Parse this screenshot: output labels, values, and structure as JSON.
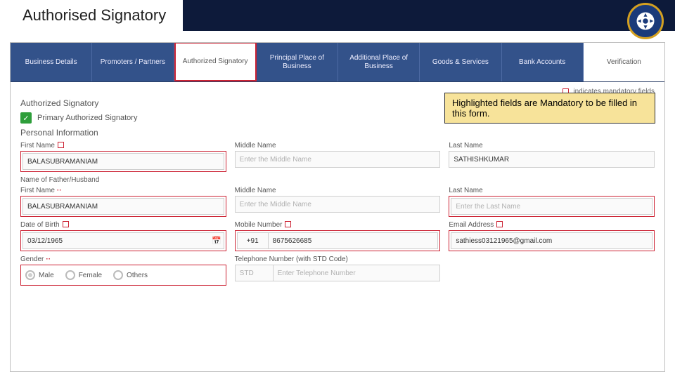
{
  "header": {
    "title": "Authorised Signatory"
  },
  "tabs": [
    {
      "label": "Business Details"
    },
    {
      "label": "Promoters / Partners"
    },
    {
      "label": "Authorized Signatory"
    },
    {
      "label": "Principal Place of Business"
    },
    {
      "label": "Additional Place of Business"
    },
    {
      "label": "Goods & Services"
    },
    {
      "label": "Bank Accounts"
    },
    {
      "label": "Verification"
    }
  ],
  "legend": {
    "text": "indicates mandatory fields"
  },
  "section": {
    "title": "Authorized Signatory",
    "primary_label": "Primary Authorized Signatory",
    "personal_info": "Personal Information"
  },
  "callout": {
    "text": "Highlighted fields are Mandatory to be filled in this form."
  },
  "name": {
    "first_label": "First Name",
    "first_value": "BALASUBRAMANIAM",
    "middle_label": "Middle Name",
    "middle_placeholder": "Enter the Middle Name",
    "last_label": "Last Name",
    "last_value": "SATHISHKUMAR"
  },
  "father": {
    "heading": "Name of Father/Husband",
    "first_label": "First Name",
    "first_value": "BALASUBRAMANIAM",
    "middle_label": "Middle Name",
    "middle_placeholder": "Enter the Middle Name",
    "last_label": "Last Name",
    "last_placeholder": "Enter the Last Name"
  },
  "row3": {
    "dob_label": "Date of Birth",
    "dob_value": "03/12/1965",
    "mobile_label": "Mobile Number",
    "mobile_cc": "+91",
    "mobile_value": "8675626685",
    "email_label": "Email Address",
    "email_value": "sathiess03121965@gmail.com"
  },
  "row4": {
    "gender_label": "Gender",
    "gender_options": {
      "male": "Male",
      "female": "Female",
      "others": "Others"
    },
    "tel_label": "Telephone Number (with STD Code)",
    "tel_std_placeholder": "STD",
    "tel_num_placeholder": "Enter Telephone Number"
  }
}
